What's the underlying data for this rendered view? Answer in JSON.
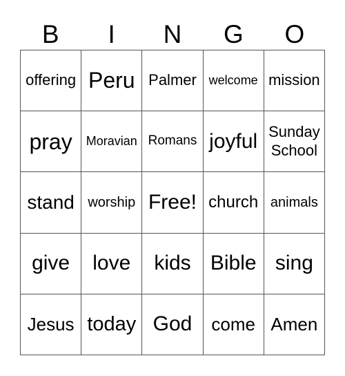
{
  "header": [
    "B",
    "I",
    "N",
    "G",
    "O"
  ],
  "cells": [
    [
      "offering",
      "Peru",
      "Palmer",
      "welcome",
      "mission"
    ],
    [
      "pray",
      "Moravian",
      "Romans",
      "joyful",
      "Sunday\nSchool"
    ],
    [
      "stand",
      "worship",
      "Free!",
      "church",
      "animals"
    ],
    [
      "give",
      "love",
      "kids",
      "Bible",
      "sing"
    ],
    [
      "Jesus",
      "today",
      "God",
      "come",
      "Amen"
    ]
  ]
}
